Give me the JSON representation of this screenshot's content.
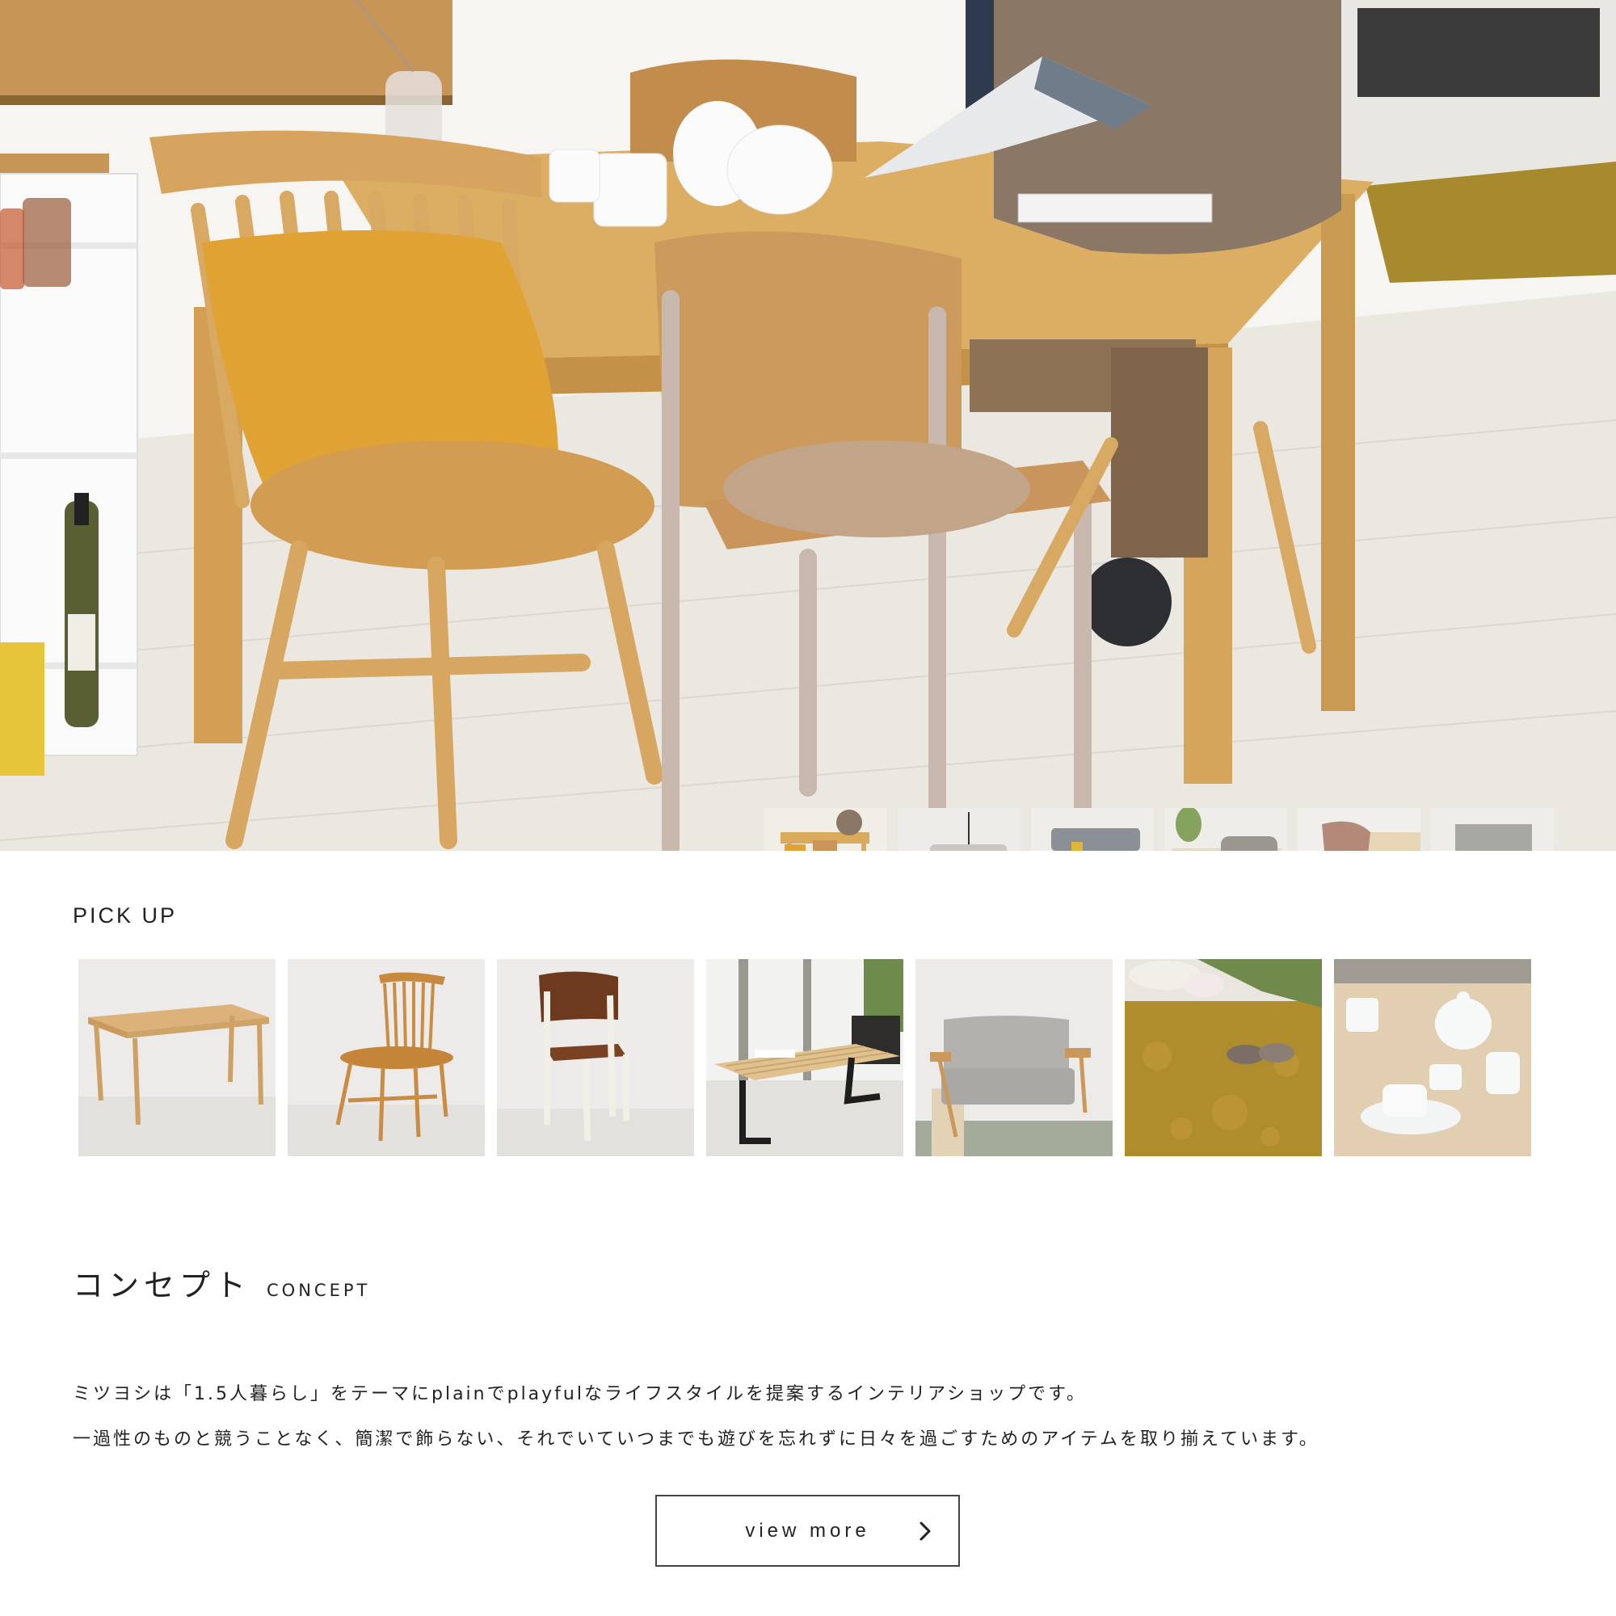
{
  "hero": {
    "thumbnails": [
      {
        "icon": "dining-scene-thumb"
      },
      {
        "icon": "sofa-room-thumb"
      },
      {
        "icon": "living-bench-thumb"
      },
      {
        "icon": "bedroom-thumb"
      },
      {
        "icon": "office-chair-thumb"
      },
      {
        "icon": "storage-box-thumb"
      }
    ],
    "active_index": 0
  },
  "pickup": {
    "title": "PICK UP",
    "items": [
      {
        "icon": "dining-table"
      },
      {
        "icon": "windsor-chair"
      },
      {
        "icon": "standard-chair"
      },
      {
        "icon": "slat-bench"
      },
      {
        "icon": "two-seat-sofa"
      },
      {
        "icon": "shaggy-rug"
      },
      {
        "icon": "teapot-set"
      }
    ]
  },
  "concept": {
    "title_jp": "コンセプト",
    "title_en": "CONCEPT",
    "line1": "ミツヨシは「1.5人暮らし」をテーマにplainでplayfulなライフスタイルを提案するインテリアショップです。",
    "line2": "一過性のものと競うことなく、簡潔で飾らない、それでいていつまでも遊びを忘れずに日々を過ごすためのアイテムを取り揃えています。",
    "button_label": "view more"
  },
  "colors": {
    "text": "#222222",
    "wood": "#d9a95c",
    "mustard": "#e0a233",
    "floor": "#ece9e3"
  }
}
